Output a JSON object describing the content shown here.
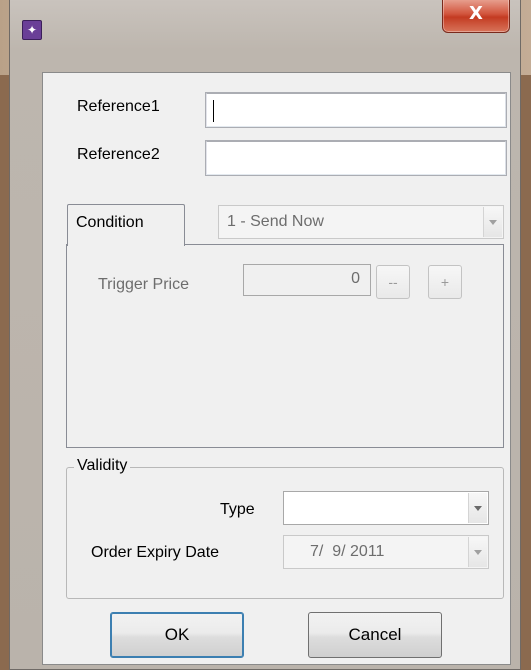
{
  "window": {
    "close_glyph": "X",
    "app_icon": "purple-gear-icon"
  },
  "references": {
    "reference1_label": "Reference1",
    "reference1_value": "",
    "reference2_label": "Reference2",
    "reference2_value": ""
  },
  "condition": {
    "tab_label": "Condition",
    "selected": "1 - Send Now",
    "trigger_price_label": "Trigger Price",
    "trigger_price_value": "0",
    "decrement_label": "--",
    "increment_label": "+"
  },
  "validity": {
    "group_label": "Validity",
    "type_label": "Type",
    "type_value": "",
    "expiry_label": "Order Expiry Date",
    "expiry_value": "7/  9/ 2011"
  },
  "buttons": {
    "ok": "OK",
    "cancel": "Cancel"
  }
}
